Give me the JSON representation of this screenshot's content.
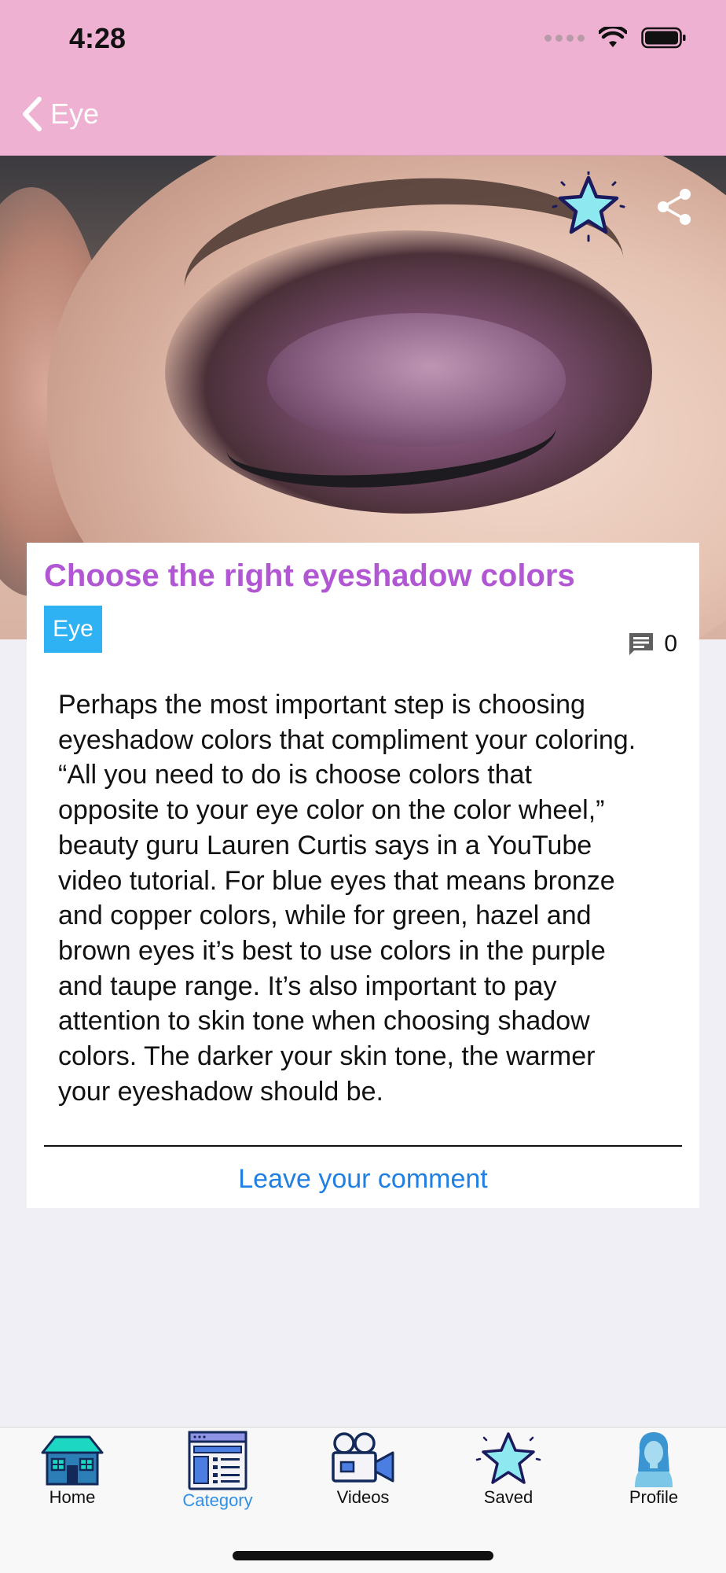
{
  "status_bar": {
    "time": "4:28"
  },
  "nav": {
    "back_label": "Eye"
  },
  "article": {
    "title": "Choose the right eyeshadow colors",
    "category": "Eye",
    "comment_count": "0",
    "body_lines": [
      "Perhaps the most important step is choosing",
      "eyeshadow colors that compliment your coloring.",
      "“All you need to do is choose colors that",
      "opposite to your eye color on the color wheel,”",
      "beauty guru Lauren Curtis says in a YouTube",
      "video tutorial. For blue eyes that means bronze",
      "and copper colors, while for green, hazel and",
      "brown eyes it’s best to use colors in the purple",
      "and taupe range. It’s also important to pay",
      "attention to skin tone when choosing shadow",
      "colors. The darker your skin tone, the warmer",
      "your eyeshadow should be."
    ],
    "comment_link": "Leave your comment"
  },
  "tabs": [
    {
      "label": "Home",
      "icon": "home-icon",
      "active": false
    },
    {
      "label": "Category",
      "icon": "category-icon",
      "active": true
    },
    {
      "label": "Videos",
      "icon": "video-camera-icon",
      "active": false
    },
    {
      "label": "Saved",
      "icon": "star-icon",
      "active": false
    },
    {
      "label": "Profile",
      "icon": "profile-icon",
      "active": false
    }
  ],
  "colors": {
    "header_pink": "#efb1d2",
    "title_purple": "#b257d3",
    "tag_blue": "#2fb2f3",
    "link_blue": "#1f7fe3",
    "active_tab": "#2f8fe6"
  }
}
